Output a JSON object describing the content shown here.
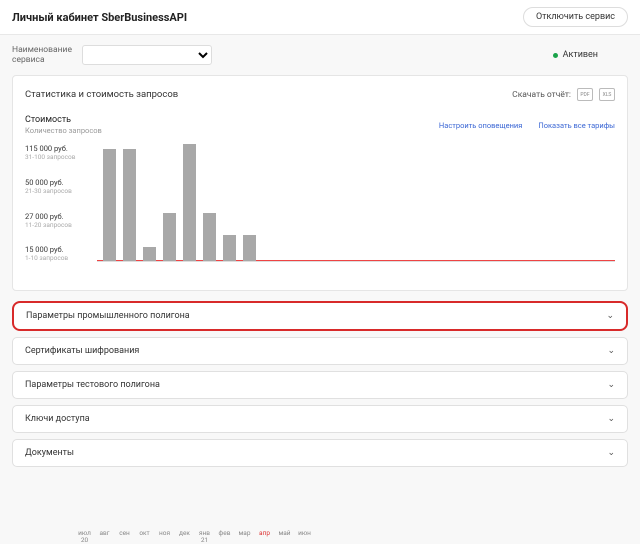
{
  "header": {
    "title": "Личный кабинет SberBusinessAPI",
    "disable": "Отключить сервис"
  },
  "service": {
    "label": "Наименование\nсервиса",
    "status": "Активен"
  },
  "card": {
    "title": "Статистика и стоимость запросов",
    "download": "Скачать отчёт:",
    "pdf": "PDF",
    "xls": "XLS",
    "tab1": "Стоимость",
    "tab2": "Количество запросов",
    "link1": "Настроить оповещения",
    "link2": "Показать все тарифы"
  },
  "yticks": [
    {
      "p": "115 000 руб.",
      "s": "31-100 запросов"
    },
    {
      "p": "50 000 руб.",
      "s": "21-30 запросов"
    },
    {
      "p": "27 000 руб.",
      "s": "11-20 запросов"
    },
    {
      "p": "15 000 руб.",
      "s": "1-10 запросов"
    }
  ],
  "xlabels": [
    "июл\n20",
    "авг",
    "сен",
    "окт",
    "ноя",
    "дек",
    "янв\n21",
    "фев",
    "мар",
    "апр",
    "май",
    "июн"
  ],
  "chart_data": {
    "type": "bar",
    "categories": [
      "июл 20",
      "авг",
      "сен",
      "окт",
      "ноя",
      "дек",
      "янв 21",
      "фев",
      "мар",
      "апр",
      "май",
      "июн"
    ],
    "values": [
      115000,
      115000,
      15000,
      50000,
      120000,
      50000,
      27000,
      27000,
      null,
      null,
      null,
      null
    ],
    "ylabel": "Стоимость",
    "ylim": [
      0,
      120000
    ],
    "yticks": [
      15000,
      27000,
      50000,
      115000
    ],
    "current_month_index": 9
  },
  "accordion": [
    {
      "label": "Параметры промышленного полигона",
      "hl": true
    },
    {
      "label": "Сертификаты шифрования"
    },
    {
      "label": "Параметры тестового полигона"
    },
    {
      "label": "Ключи доступа"
    },
    {
      "label": "Документы"
    }
  ]
}
